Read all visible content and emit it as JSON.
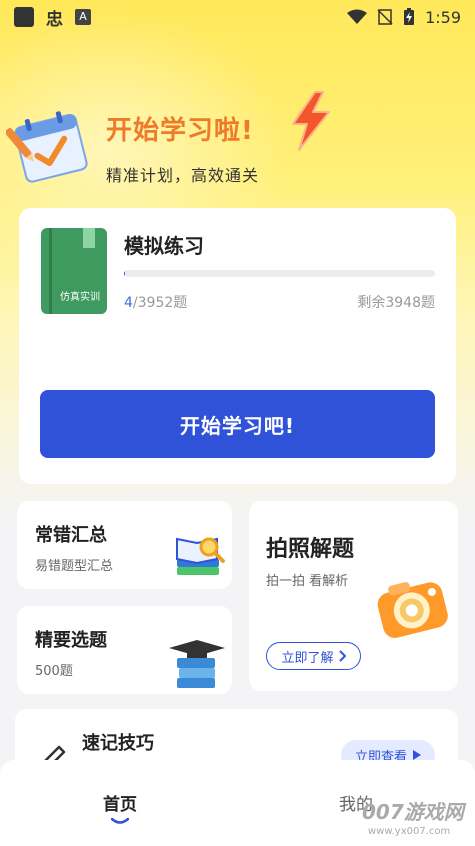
{
  "status_bar": {
    "app_glyph": "忠",
    "a_badge": "A",
    "time": "1:59"
  },
  "hero": {
    "title": "开始学习啦!",
    "subtitle": "精准计划，高效通关"
  },
  "practice": {
    "book_label": "仿真实训",
    "title": "模拟练习",
    "done": "4",
    "total_text": "/3952题",
    "progress_fraction": 0.001,
    "remaining": "剩余3948题",
    "start_button": "开始学习吧!"
  },
  "tiles": {
    "errors": {
      "title": "常错汇总",
      "subtitle": "易错题型汇总"
    },
    "select": {
      "title": "精要选题",
      "subtitle": "500题"
    },
    "photo": {
      "title": "拍照解题",
      "subtitle": "拍一拍 看解析",
      "button": "立即了解"
    },
    "memo": {
      "title": "速记技巧",
      "button": "立即查看"
    }
  },
  "bottom_nav": {
    "home": "首页",
    "mine": "我的"
  },
  "watermark": {
    "logo": "007游戏网",
    "url": "www.yx007.com"
  },
  "colors": {
    "accent": "#2f52d8",
    "hero_title": "#ee7a2a",
    "book_green": "#3e9a5e"
  }
}
